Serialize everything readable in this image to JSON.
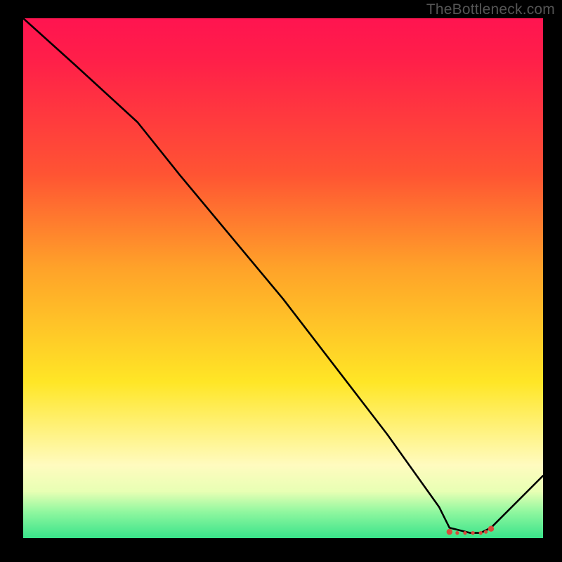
{
  "watermark": "TheBottleneck.com",
  "chart_data": {
    "type": "line",
    "title": "",
    "xlabel": "",
    "ylabel": "",
    "xlim": [
      0,
      100
    ],
    "ylim": [
      0,
      100
    ],
    "grid": false,
    "legend": false,
    "series": [
      {
        "name": "bottleneck-curve",
        "color": "#000000",
        "x": [
          0,
          10,
          22,
          30,
          40,
          50,
          60,
          70,
          80,
          82,
          86,
          88,
          90,
          100
        ],
        "y": [
          100,
          91,
          80,
          70,
          58,
          46,
          33,
          20,
          6,
          2,
          1,
          1,
          2,
          12
        ]
      }
    ],
    "markers": {
      "name": "highlight-band",
      "color": "#d94a3a",
      "x": [
        82,
        83.5,
        85,
        86.5,
        88,
        89,
        90
      ],
      "y": [
        1.2,
        1.0,
        1.0,
        1.0,
        1.0,
        1.2,
        1.8
      ]
    }
  }
}
